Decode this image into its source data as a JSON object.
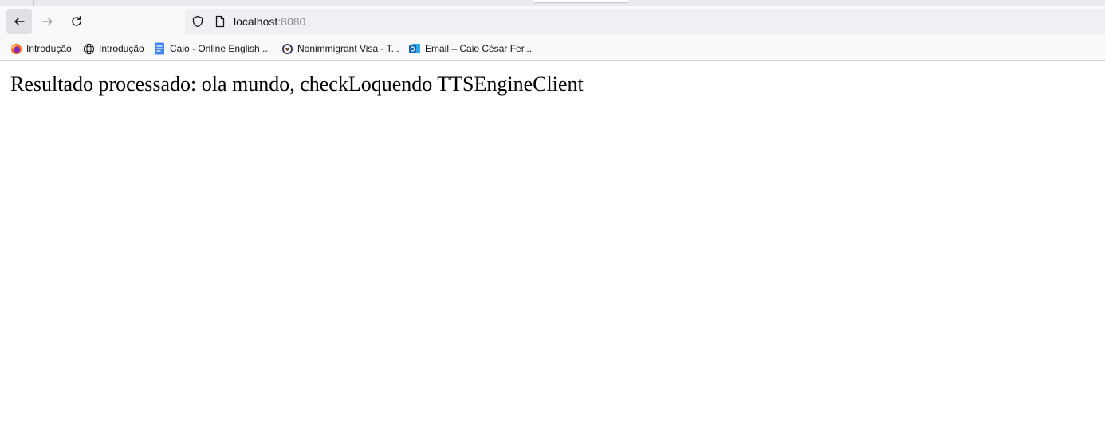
{
  "browser": {
    "url_host": "localhost",
    "url_port": ":8080",
    "bookmarks": [
      {
        "label": "Introdução",
        "icon": "firefox-icon"
      },
      {
        "label": "Introdução",
        "icon": "globe-icon"
      },
      {
        "label": "Caio - Online English ...",
        "icon": "google-docs-icon"
      },
      {
        "label": "Nonimmigrant Visa - T...",
        "icon": "us-seal-icon"
      },
      {
        "label": "Email – Caio César Fer...",
        "icon": "outlook-icon"
      }
    ]
  },
  "page": {
    "result_text": "Resultado processado: ola mundo, checkLoquendo TTSEngineClient"
  },
  "colors": {
    "toolbar_bg": "#f9f9fb",
    "urlbar_bg": "#f0f0f4",
    "tabstrip_bg": "#e9e8ee"
  }
}
